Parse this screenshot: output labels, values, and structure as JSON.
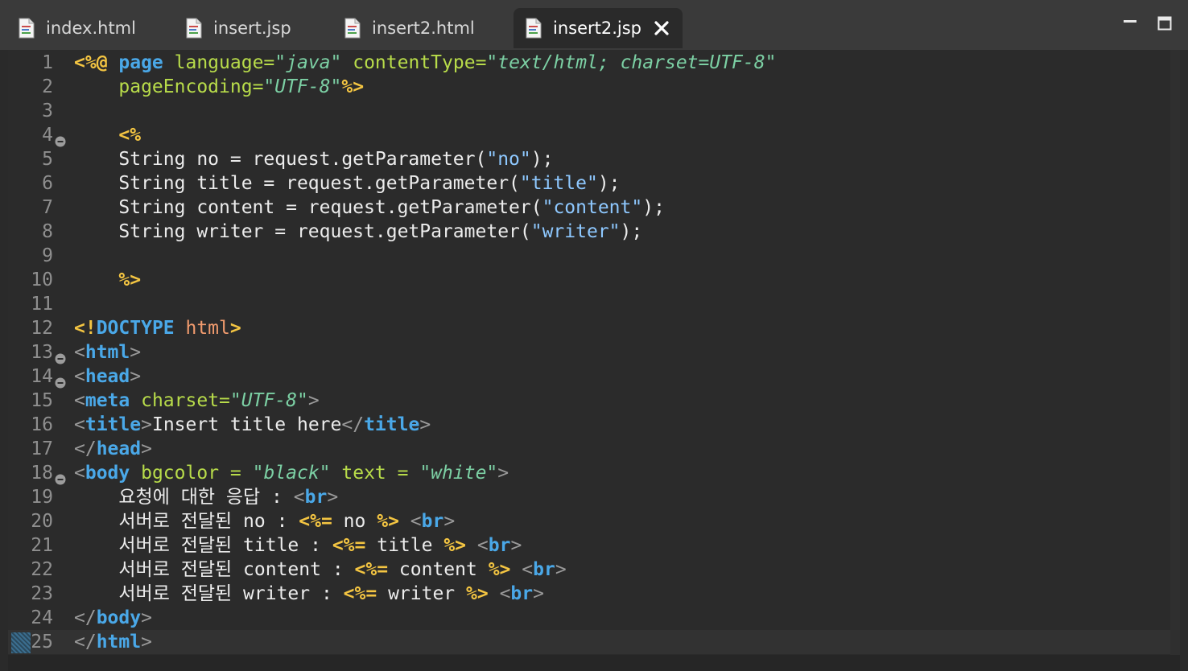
{
  "tabs": [
    {
      "label": "index.html",
      "active": false
    },
    {
      "label": "insert.jsp",
      "active": false
    },
    {
      "label": "insert2.html",
      "active": false
    },
    {
      "label": "insert2.jsp",
      "active": true
    }
  ],
  "icons": {
    "file": "file-icon",
    "close": "close-icon",
    "minimize": "minimize-icon",
    "maximize": "maximize-icon",
    "fold": "fold-collapse-icon"
  },
  "colors": {
    "background": "#2b2b2b",
    "directive": "#f4c542",
    "keyword": "#4aa8e8",
    "attribute": "#b8dc4a",
    "string": "#7cd0a4"
  },
  "editor": {
    "current_line": 25,
    "lines": [
      {
        "n": "1",
        "t": [
          [
            "dir",
            "<%@ "
          ],
          [
            "kw",
            "page "
          ],
          [
            "attr",
            "language"
          ],
          [
            "eq",
            "="
          ],
          [
            "str",
            "\"java\""
          ],
          [
            "txt",
            " "
          ],
          [
            "attr",
            "contentType"
          ],
          [
            "eq",
            "="
          ],
          [
            "str",
            "\"text/html; charset=UTF-8\""
          ]
        ]
      },
      {
        "n": "2",
        "t": [
          [
            "txt",
            "    "
          ],
          [
            "attr",
            "pageEncoding"
          ],
          [
            "eq",
            "="
          ],
          [
            "str",
            "\"UTF-8\""
          ],
          [
            "dir",
            "%>"
          ]
        ]
      },
      {
        "n": "3",
        "t": []
      },
      {
        "n": "4",
        "fold": true,
        "t": [
          [
            "txt",
            "    "
          ],
          [
            "dir",
            "<%"
          ]
        ]
      },
      {
        "n": "5",
        "t": [
          [
            "txt",
            "    String no = request.getParameter("
          ],
          [
            "jstr",
            "\"no\""
          ],
          [
            "txt",
            ");"
          ]
        ]
      },
      {
        "n": "6",
        "t": [
          [
            "txt",
            "    String title = request.getParameter("
          ],
          [
            "jstr",
            "\"title\""
          ],
          [
            "txt",
            ");"
          ]
        ]
      },
      {
        "n": "7",
        "t": [
          [
            "txt",
            "    String content = request.getParameter("
          ],
          [
            "jstr",
            "\"content\""
          ],
          [
            "txt",
            ");"
          ]
        ]
      },
      {
        "n": "8",
        "t": [
          [
            "txt",
            "    String writer = request.getParameter("
          ],
          [
            "jstr",
            "\"writer\""
          ],
          [
            "txt",
            ");"
          ]
        ]
      },
      {
        "n": "9",
        "t": []
      },
      {
        "n": "10",
        "t": [
          [
            "txt",
            "    "
          ],
          [
            "dir",
            "%>"
          ]
        ]
      },
      {
        "n": "11",
        "t": []
      },
      {
        "n": "12",
        "t": [
          [
            "dir",
            "<!"
          ],
          [
            "kw",
            "DOCTYPE "
          ],
          [
            "doct",
            "html"
          ],
          [
            "dir",
            ">"
          ]
        ]
      },
      {
        "n": "13",
        "fold": true,
        "t": [
          [
            "bracket",
            "<"
          ],
          [
            "tag",
            "html"
          ],
          [
            "bracket",
            ">"
          ]
        ]
      },
      {
        "n": "14",
        "fold": true,
        "t": [
          [
            "bracket",
            "<"
          ],
          [
            "tag",
            "head"
          ],
          [
            "bracket",
            ">"
          ]
        ]
      },
      {
        "n": "15",
        "t": [
          [
            "bracket",
            "<"
          ],
          [
            "tag",
            "meta "
          ],
          [
            "attr",
            "charset"
          ],
          [
            "eq",
            "="
          ],
          [
            "str",
            "\"UTF-8\""
          ],
          [
            "bracket",
            ">"
          ]
        ]
      },
      {
        "n": "16",
        "t": [
          [
            "bracket",
            "<"
          ],
          [
            "tag",
            "title"
          ],
          [
            "bracket",
            ">"
          ],
          [
            "txt",
            "Insert title here"
          ],
          [
            "bracket",
            "</"
          ],
          [
            "tag",
            "title"
          ],
          [
            "bracket",
            ">"
          ]
        ]
      },
      {
        "n": "17",
        "t": [
          [
            "bracket",
            "</"
          ],
          [
            "tag",
            "head"
          ],
          [
            "bracket",
            ">"
          ]
        ]
      },
      {
        "n": "18",
        "fold": true,
        "t": [
          [
            "bracket",
            "<"
          ],
          [
            "tag",
            "body "
          ],
          [
            "attr",
            "bgcolor"
          ],
          [
            "eq",
            " = "
          ],
          [
            "str",
            "\"black\""
          ],
          [
            "txt",
            " "
          ],
          [
            "attr",
            "text"
          ],
          [
            "eq",
            " = "
          ],
          [
            "str",
            "\"white\""
          ],
          [
            "bracket",
            ">"
          ]
        ]
      },
      {
        "n": "19",
        "t": [
          [
            "txt",
            "    요청에 대한 응답 : "
          ],
          [
            "bracket",
            "<"
          ],
          [
            "tag",
            "br"
          ],
          [
            "bracket",
            ">"
          ]
        ]
      },
      {
        "n": "20",
        "t": [
          [
            "txt",
            "    서버로 전달된 no : "
          ],
          [
            "dir",
            "<%="
          ],
          [
            "txt",
            " no "
          ],
          [
            "dir",
            "%>"
          ],
          [
            "txt",
            " "
          ],
          [
            "bracket",
            "<"
          ],
          [
            "tag",
            "br"
          ],
          [
            "bracket",
            ">"
          ]
        ]
      },
      {
        "n": "21",
        "t": [
          [
            "txt",
            "    서버로 전달된 title : "
          ],
          [
            "dir",
            "<%="
          ],
          [
            "txt",
            " title "
          ],
          [
            "dir",
            "%>"
          ],
          [
            "txt",
            " "
          ],
          [
            "bracket",
            "<"
          ],
          [
            "tag",
            "br"
          ],
          [
            "bracket",
            ">"
          ]
        ]
      },
      {
        "n": "22",
        "t": [
          [
            "txt",
            "    서버로 전달된 content : "
          ],
          [
            "dir",
            "<%="
          ],
          [
            "txt",
            " content "
          ],
          [
            "dir",
            "%>"
          ],
          [
            "txt",
            " "
          ],
          [
            "bracket",
            "<"
          ],
          [
            "tag",
            "br"
          ],
          [
            "bracket",
            ">"
          ]
        ]
      },
      {
        "n": "23",
        "t": [
          [
            "txt",
            "    서버로 전달된 writer : "
          ],
          [
            "dir",
            "<%="
          ],
          [
            "txt",
            " writer "
          ],
          [
            "dir",
            "%>"
          ],
          [
            "txt",
            " "
          ],
          [
            "bracket",
            "<"
          ],
          [
            "tag",
            "br"
          ],
          [
            "bracket",
            ">"
          ]
        ]
      },
      {
        "n": "24",
        "t": [
          [
            "bracket",
            "</"
          ],
          [
            "tag",
            "body"
          ],
          [
            "bracket",
            ">"
          ]
        ]
      },
      {
        "n": "25",
        "t": [
          [
            "bracket",
            "</"
          ],
          [
            "tag",
            "html"
          ],
          [
            "bracket",
            ">"
          ]
        ]
      }
    ]
  }
}
